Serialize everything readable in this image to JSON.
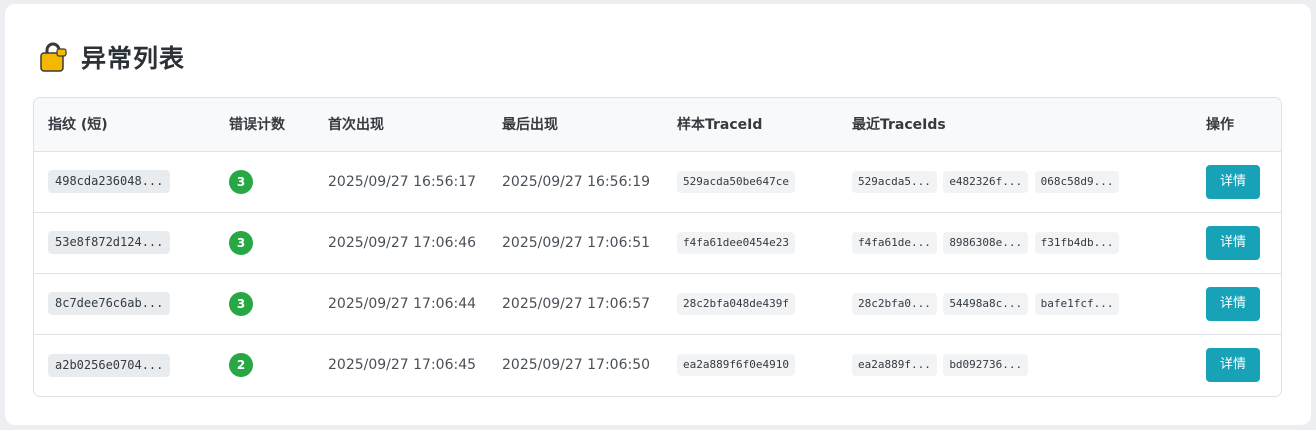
{
  "page": {
    "title": "异常列表",
    "icon": "lock-icon"
  },
  "table": {
    "headers": [
      "指纹 (短)",
      "错误计数",
      "首次出现",
      "最后出现",
      "样本TraceId",
      "最近TraceIds",
      "操作"
    ],
    "rows": [
      {
        "fingerprint": "498cda236048...",
        "count": "3",
        "first_seen": "2025/09/27 16:56:17",
        "last_seen": "2025/09/27 16:56:19",
        "sample_trace": "529acda50be647ce",
        "recent_traces": [
          "529acda5...",
          "e482326f...",
          "068c58d9..."
        ],
        "action": "详情"
      },
      {
        "fingerprint": "53e8f872d124...",
        "count": "3",
        "first_seen": "2025/09/27 17:06:46",
        "last_seen": "2025/09/27 17:06:51",
        "sample_trace": "f4fa61dee0454e23",
        "recent_traces": [
          "f4fa61de...",
          "8986308e...",
          "f31fb4db..."
        ],
        "action": "详情"
      },
      {
        "fingerprint": "8c7dee76c6ab...",
        "count": "3",
        "first_seen": "2025/09/27 17:06:44",
        "last_seen": "2025/09/27 17:06:57",
        "sample_trace": "28c2bfa048de439f",
        "recent_traces": [
          "28c2bfa0...",
          "54498a8c...",
          "bafe1fcf..."
        ],
        "action": "详情"
      },
      {
        "fingerprint": "a2b0256e0704...",
        "count": "2",
        "first_seen": "2025/09/27 17:06:45",
        "last_seen": "2025/09/27 17:06:50",
        "sample_trace": "ea2a889f6f0e4910",
        "recent_traces": [
          "ea2a889f...",
          "bd092736..."
        ],
        "action": "详情"
      }
    ]
  },
  "colors": {
    "badge": "#28a745",
    "button": "#17a2b8",
    "icon": "#f5b800"
  }
}
